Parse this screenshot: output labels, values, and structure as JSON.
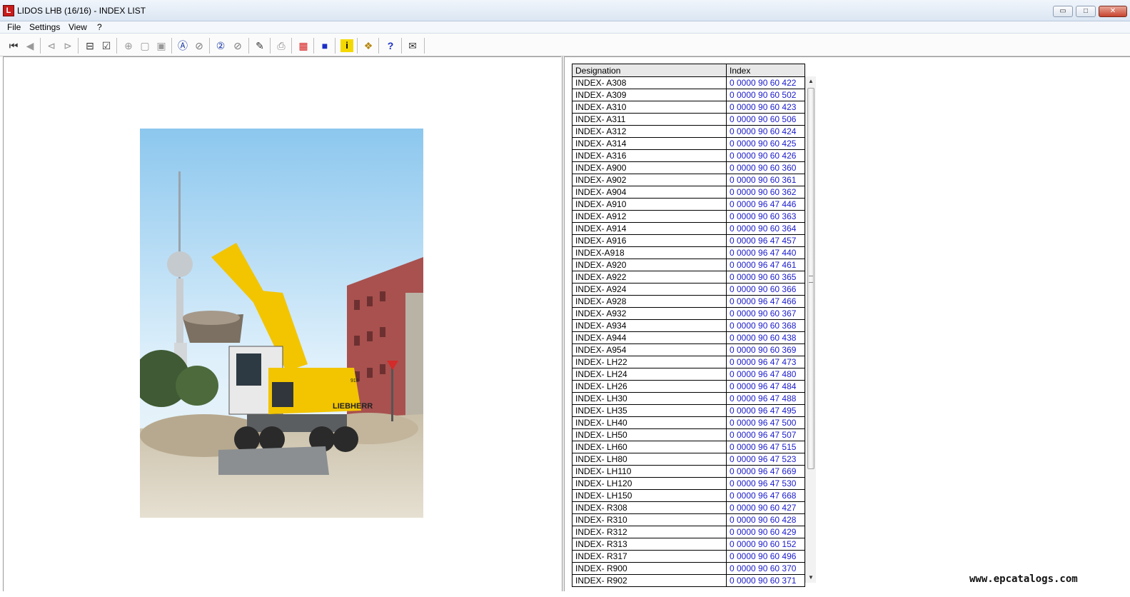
{
  "window": {
    "title": "LIDOS LHB (16/16) - INDEX LIST",
    "icon_glyph": "L",
    "minimize_glyph": "▭",
    "maximize_glyph": "□",
    "close_glyph": "✕"
  },
  "menu": [
    "File",
    "Settings",
    "View",
    "?"
  ],
  "toolbar": {
    "buttons": [
      {
        "icon": "first-page-icon",
        "glyph": "⏮"
      },
      {
        "icon": "previous-icon",
        "glyph": "◀"
      },
      {
        "icon": "back-book-icon",
        "glyph": "⊲"
      },
      {
        "icon": "forward-book-icon",
        "glyph": "⊳"
      },
      {
        "icon": "catalog-icon",
        "glyph": "⊟"
      },
      {
        "icon": "checklist-icon",
        "glyph": "☑"
      },
      {
        "icon": "zoom-icon",
        "glyph": "⊕"
      },
      {
        "icon": "page-icon",
        "glyph": "▢"
      },
      {
        "icon": "page-copy-icon",
        "glyph": "▣"
      },
      {
        "icon": "circle-a-icon",
        "glyph": "Ⓐ"
      },
      {
        "icon": "search-a-icon",
        "glyph": "⊘"
      },
      {
        "icon": "circle-2-icon",
        "glyph": "②"
      },
      {
        "icon": "search-2-icon",
        "glyph": "⊘"
      },
      {
        "icon": "edit-icon",
        "glyph": "✎"
      },
      {
        "icon": "print-icon",
        "glyph": "⎙"
      },
      {
        "icon": "grid-icon",
        "glyph": "▦"
      },
      {
        "icon": "blue-square-icon",
        "glyph": "■"
      },
      {
        "icon": "info-icon",
        "glyph": "i"
      },
      {
        "icon": "handshake-icon",
        "glyph": "❖"
      },
      {
        "icon": "lidos-help-icon",
        "glyph": "?"
      },
      {
        "icon": "mail-icon",
        "glyph": "✉"
      }
    ]
  },
  "table": {
    "headers": [
      "Designation",
      "Index"
    ],
    "rows": [
      [
        "INDEX- A308",
        "0 0000 90 60 422"
      ],
      [
        "INDEX- A309",
        "0 0000 90 60 502"
      ],
      [
        "INDEX- A310",
        "0 0000 90 60 423"
      ],
      [
        "INDEX- A311",
        "0 0000 90 60 506"
      ],
      [
        "INDEX- A312",
        "0 0000 90 60 424"
      ],
      [
        "INDEX- A314",
        "0 0000 90 60 425"
      ],
      [
        "INDEX- A316",
        "0 0000 90 60 426"
      ],
      [
        "INDEX- A900",
        "0 0000 90 60 360"
      ],
      [
        "INDEX- A902",
        "0 0000 90 60 361"
      ],
      [
        "INDEX- A904",
        "0 0000 90 60 362"
      ],
      [
        "INDEX- A910",
        "0 0000 96 47 446"
      ],
      [
        "INDEX- A912",
        "0 0000 90 60 363"
      ],
      [
        "INDEX- A914",
        "0 0000 90 60 364"
      ],
      [
        "INDEX- A916",
        "0 0000 96 47 457"
      ],
      [
        "INDEX-A918",
        "0 0000 96 47 440"
      ],
      [
        "INDEX- A920",
        "0 0000 96 47 461"
      ],
      [
        "INDEX- A922",
        "0 0000 90 60 365"
      ],
      [
        "INDEX- A924",
        "0 0000 90 60 366"
      ],
      [
        "INDEX- A928",
        "0 0000 96 47 466"
      ],
      [
        "INDEX- A932",
        "0 0000 90 60 367"
      ],
      [
        "INDEX- A934",
        "0 0000 90 60 368"
      ],
      [
        "INDEX- A944",
        "0 0000 90 60 438"
      ],
      [
        "INDEX- A954",
        "0 0000 90 60 369"
      ],
      [
        "INDEX- LH22",
        "0 0000 96 47 473"
      ],
      [
        "INDEX- LH24",
        "0 0000 96 47 480"
      ],
      [
        "INDEX- LH26",
        "0 0000 96 47 484"
      ],
      [
        "INDEX- LH30",
        "0 0000 96 47 488"
      ],
      [
        "INDEX- LH35",
        "0 0000 96 47 495"
      ],
      [
        "INDEX- LH40",
        "0 0000 96 47 500"
      ],
      [
        "INDEX- LH50",
        "0 0000 96 47 507"
      ],
      [
        "INDEX- LH60",
        "0 0000 96 47 515"
      ],
      [
        "INDEX- LH80",
        "0 0000 96 47 523"
      ],
      [
        "INDEX- LH110",
        "0 0000 96 47 669"
      ],
      [
        "INDEX- LH120",
        "0 0000 96 47 530"
      ],
      [
        "INDEX- LH150",
        "0 0000 96 47 668"
      ],
      [
        "INDEX- R308",
        "0 0000 90 60 427"
      ],
      [
        "INDEX- R310",
        "0 0000 90 60 428"
      ],
      [
        "INDEX- R312",
        "0 0000 90 60 429"
      ],
      [
        "INDEX- R313",
        "0 0000 90 60 152"
      ],
      [
        "INDEX- R317",
        "0 0000 90 60 496"
      ],
      [
        "INDEX- R900",
        "0 0000 90 60 370"
      ],
      [
        "INDEX- R902",
        "0 0000 90 60 371"
      ]
    ]
  },
  "scrollbar": {
    "up_glyph": "▲",
    "down_glyph": "▼"
  },
  "photo": {
    "brand_text": "LIEBHERR",
    "model_text": "918"
  },
  "watermark": "www.epcatalogs.com",
  "colors": {
    "link": "#1a1acc",
    "accent": "#c81b1b"
  }
}
